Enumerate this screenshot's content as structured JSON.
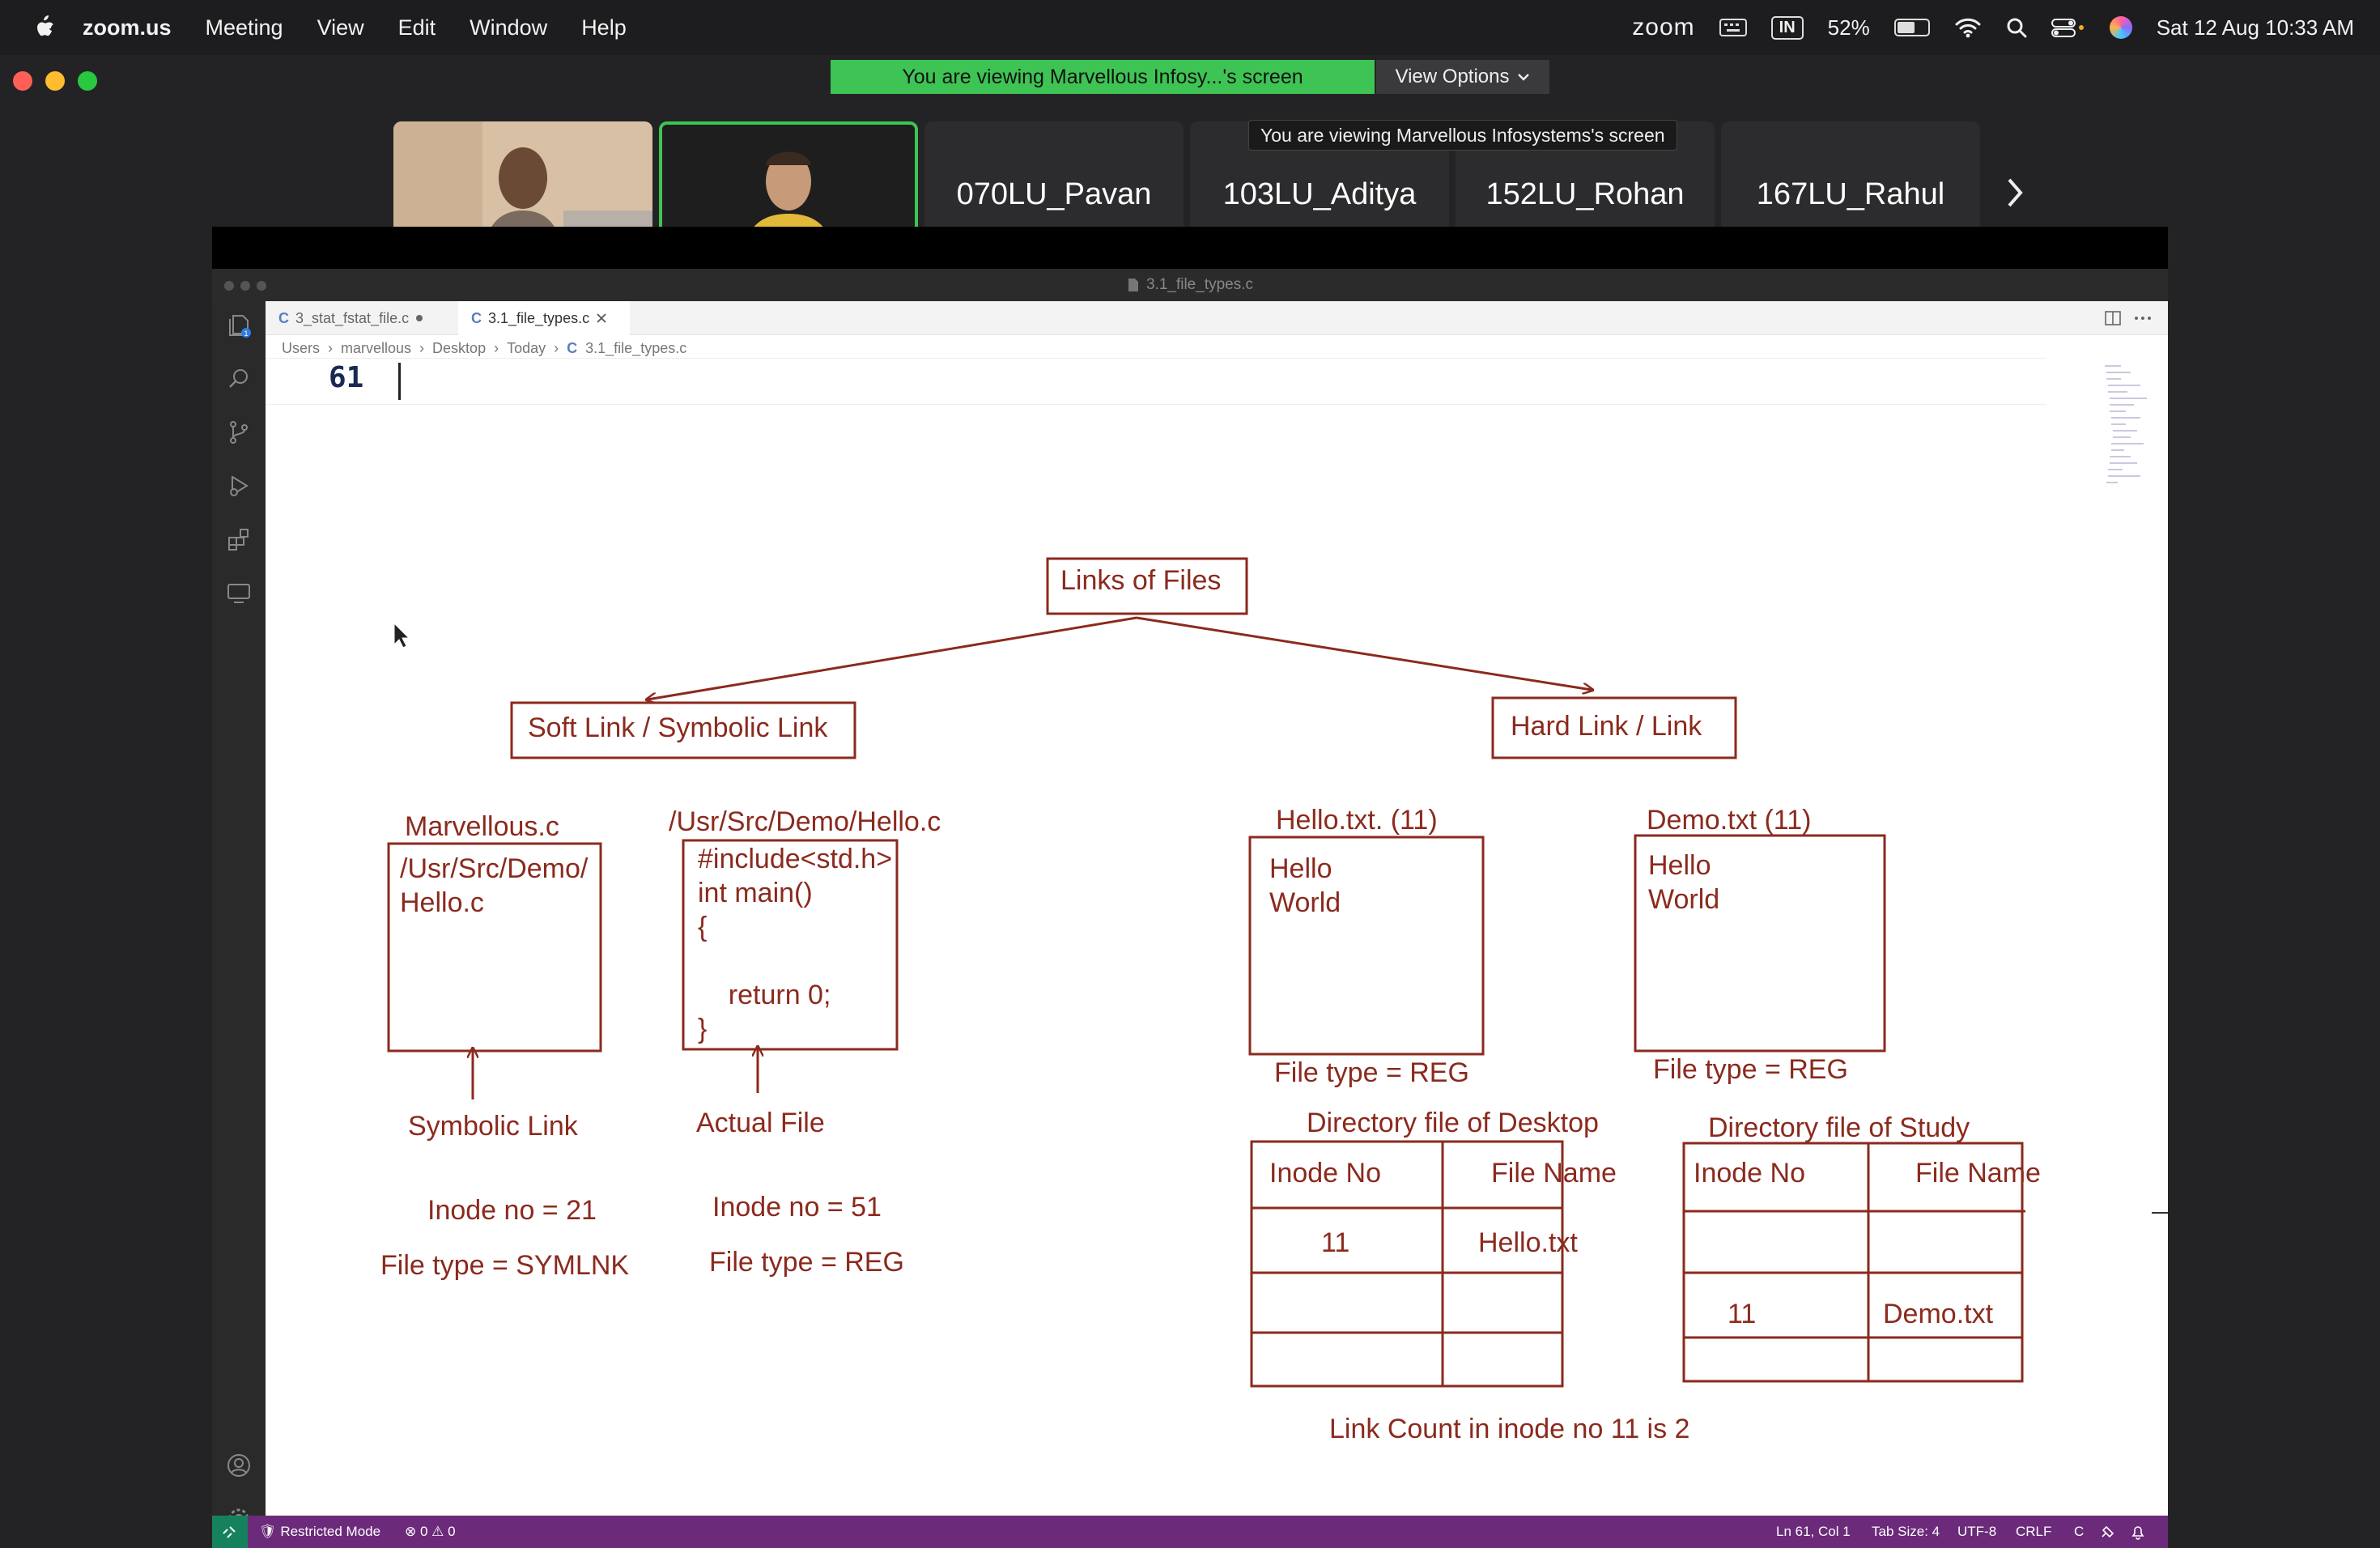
{
  "menubar": {
    "app": "zoom.us",
    "items": [
      "Meeting",
      "View",
      "Edit",
      "Window",
      "Help"
    ],
    "zoom_label": "zoom",
    "input_source": "IN",
    "battery": "52%",
    "battery_level": 0.52,
    "datetime": "Sat 12 Aug  10:33 AM"
  },
  "zoom": {
    "banner": "You are viewing Marvellous Infosy...'s screen",
    "view_options": "View Options",
    "tooltip": "You are viewing Marvellous Infosystems's screen",
    "participants": [
      "070LU_Pavan",
      "103LU_Aditya",
      "152LU_Rohan",
      "167LU_Rahul"
    ]
  },
  "vscode": {
    "title": "3.1_file_types.c",
    "tabs": [
      {
        "label": "3_stat_fstat_file.c",
        "modified": true
      },
      {
        "label": "3.1_file_types.c",
        "active": true
      }
    ],
    "breadcrumb": [
      "Users",
      "marvellous",
      "Desktop",
      "Today",
      "3.1_file_types.c"
    ],
    "line_number": "61",
    "explorer_badge": "1",
    "status": {
      "restricted": "Restricted Mode",
      "problems": "0",
      "warnings": "0",
      "position": "Ln 61, Col 1",
      "tab_size": "Tab Size: 4",
      "encoding": "UTF-8",
      "eol": "CRLF",
      "language": "C"
    }
  },
  "diagram": {
    "root": "Links of Files",
    "soft_link": "Soft Link / Symbolic Link",
    "hard_link": "Hard Link / Link",
    "symlink_file_name": "Marvellous.c",
    "symlink_content": "/Usr/Src/Demo/\nHello.c",
    "actual_file_name": "/Usr/Src/Demo/Hello.c",
    "actual_content": "#include<std.h>\nint main()\n{\n\n    return 0;\n}",
    "symlink_caption": "Symbolic Link",
    "actual_caption": "Actual File",
    "symlink_inode": "Inode no = 21",
    "symlink_type": "File type = SYMLNK",
    "actual_inode": "Inode no = 51",
    "actual_type": "File type = REG",
    "hello_name": "Hello.txt. (11)",
    "hello_content": "Hello\nWorld",
    "hello_type": "File type = REG",
    "demo_name": "Demo.txt  (11)",
    "demo_content": "Hello\nWorld",
    "demo_type": "File type = REG",
    "dir_desktop_title": "Directory file of Desktop",
    "dir_study_title": "Directory file of Study",
    "col_inode": "Inode No",
    "col_name": "File Name",
    "desktop_row_inode": "11",
    "desktop_row_name": "Hello.txt",
    "study_row_inode": "11",
    "study_row_name": "Demo.txt",
    "link_count": "Link Count in inode no 11 is 2"
  },
  "colors": {
    "ink": "#8b2a1e",
    "status_bar": "#6b2a7a",
    "zoom_green": "#3ec454"
  }
}
